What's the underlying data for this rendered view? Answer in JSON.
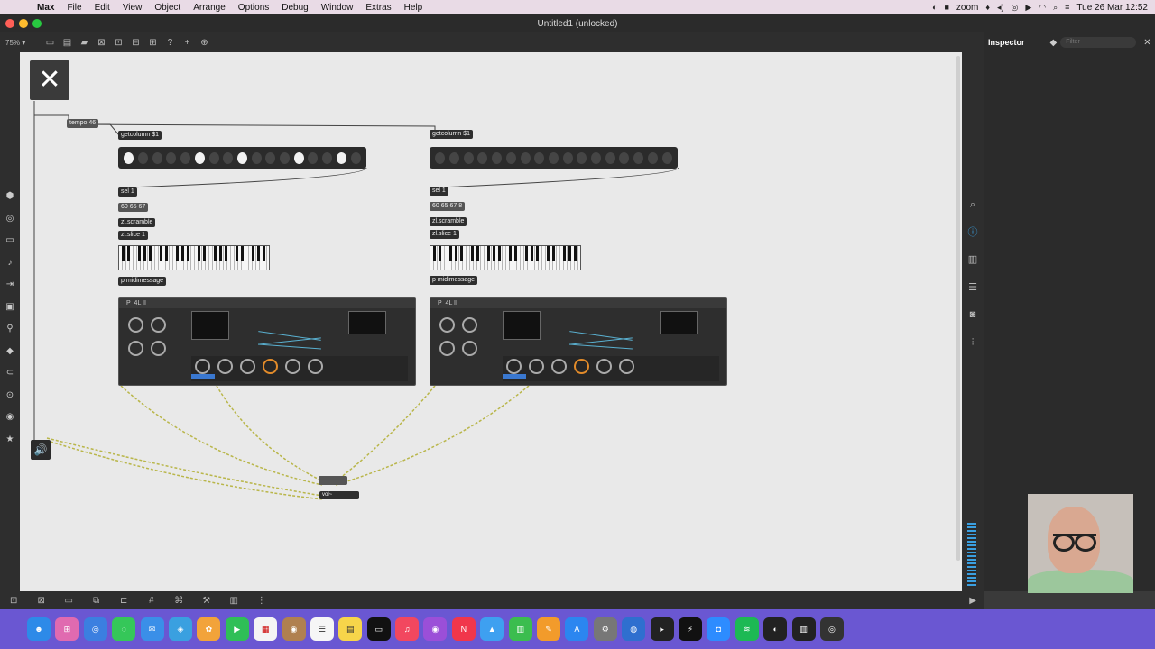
{
  "menubar": {
    "items": [
      "Max",
      "File",
      "Edit",
      "View",
      "Object",
      "Arrange",
      "Options",
      "Debug",
      "Window",
      "Extras",
      "Help"
    ],
    "zoom_app": "zoom",
    "clock": "Tue 26 Mar  12:52"
  },
  "window": {
    "title": "Untitled1 (unlocked)"
  },
  "toolbar": {
    "zoom_level": "75% ▾"
  },
  "inspector": {
    "title": "Inspector",
    "filter_placeholder": "Filter"
  },
  "patcher": {
    "tempo_msg": "tempo 46",
    "left": {
      "getcolumn": "getcolumn $1",
      "sel": "sel 1",
      "notes": "60 65 67",
      "scramble": "zl.scramble",
      "slice": "zl.slice 1",
      "midi": "p midimessage",
      "steps": [
        1,
        0,
        0,
        0,
        0,
        1,
        0,
        0,
        1,
        0,
        0,
        0,
        1,
        0,
        0,
        1,
        0
      ],
      "synth_name": "P_4L II"
    },
    "right": {
      "getcolumn": "getcolumn $1",
      "sel": "sel 1",
      "notes": "60 65 67 8",
      "scramble": "zl.scramble",
      "slice": "zl.slice 1",
      "midi": "p midimessage",
      "steps": [
        0,
        0,
        0,
        0,
        0,
        0,
        0,
        0,
        0,
        0,
        0,
        0,
        0,
        0,
        0,
        0,
        0
      ],
      "synth_name": "P_4L II"
    },
    "dac_label": "vol~"
  },
  "colors": {
    "accent": "#3a9fe0",
    "menubar_bg": "#e9dbe6",
    "dock_bg": "#6a57d2",
    "knob_accent": "#e28b2a"
  }
}
